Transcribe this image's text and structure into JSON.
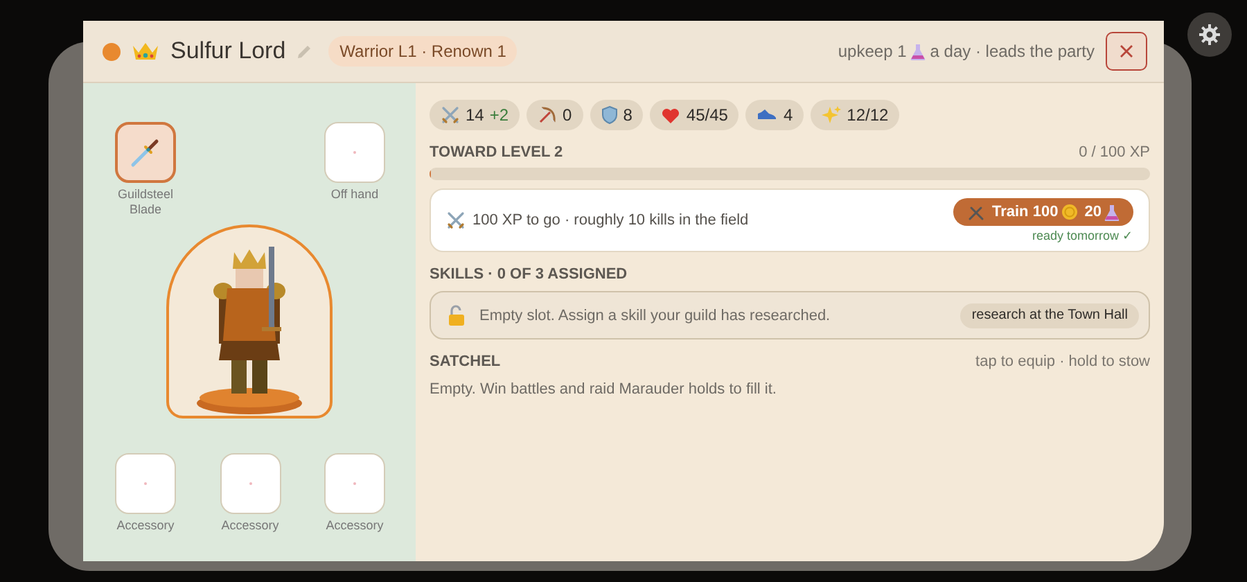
{
  "header": {
    "name": "Sulfur Lord",
    "badge": "Warrior L1 · Renown 1",
    "upkeep_before": "upkeep 1",
    "upkeep_after": "a day · leads the party"
  },
  "equipment": {
    "top": [
      {
        "label": "Guildsteel Blade",
        "filled": true
      },
      {
        "label": "Off hand",
        "filled": false
      }
    ],
    "bottom": [
      {
        "label": "Accessory",
        "filled": false
      },
      {
        "label": "Accessory",
        "filled": false
      },
      {
        "label": "Accessory",
        "filled": false
      }
    ]
  },
  "stats": [
    {
      "kind": "attack",
      "value": "14",
      "bonus": "+2"
    },
    {
      "kind": "ranged",
      "value": "0"
    },
    {
      "kind": "defense",
      "value": "8"
    },
    {
      "kind": "health",
      "value": "45/45"
    },
    {
      "kind": "speed",
      "value": "4"
    },
    {
      "kind": "magic",
      "value": "12/12"
    }
  ],
  "xp": {
    "title": "TOWARD LEVEL 2",
    "reading": "0 / 100 XP",
    "level": 0
  },
  "hint": {
    "text": "100 XP to go · roughly 10 kills in the field",
    "train_label": "Train",
    "gold": "100",
    "potions": "20",
    "note": "ready tomorrow ✓"
  },
  "skills": {
    "title": "SKILLS · 0 OF 3 ASSIGNED",
    "slot_text": "Empty slot. Assign a skill your guild has researched.",
    "action": "research at the Town Hall"
  },
  "satchel": {
    "title": "SATCHEL",
    "hint": "tap to equip · hold to stow",
    "text": "Empty. Win battles and raid Marauder holds to fill it."
  }
}
